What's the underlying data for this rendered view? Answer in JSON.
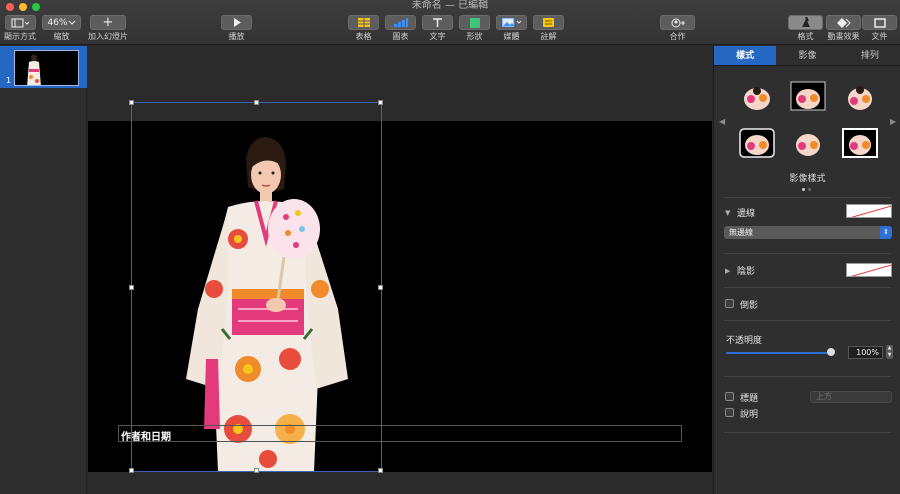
{
  "window": {
    "title": "未命名 — 已編輯"
  },
  "toolbar": {
    "view_label": "顯示方式",
    "zoom_value": "46%",
    "zoom_label": "縮放",
    "add_slide_label": "加入幻燈片",
    "play_label": "播放",
    "table_label": "表格",
    "chart_label": "圖表",
    "text_label": "文字",
    "shape_label": "形狀",
    "media_label": "媒體",
    "comment_label": "註解",
    "collaborate_label": "合作",
    "format_label": "格式",
    "animate_label": "動畫效果",
    "document_label": "文件"
  },
  "navigator": {
    "slide_number": "1"
  },
  "slide": {
    "text_box": "作者和日期"
  },
  "inspector": {
    "tabs": [
      "樣式",
      "影像",
      "排列"
    ],
    "image_styles_caption": "影像樣式",
    "border_label": "邊線",
    "border_popup_value": "無邊線",
    "shadow_label": "陰影",
    "reflection_label": "倒影",
    "opacity_label": "不透明度",
    "opacity_value": "100%",
    "opacity_fraction": 1.0,
    "title_label": "標題",
    "title_position_value": "上方",
    "caption_label": "說明"
  },
  "colors": {
    "accent": "#2468c4",
    "toolbar": "#333333",
    "canvas": "#2b2b2b",
    "slide": "#000000"
  }
}
